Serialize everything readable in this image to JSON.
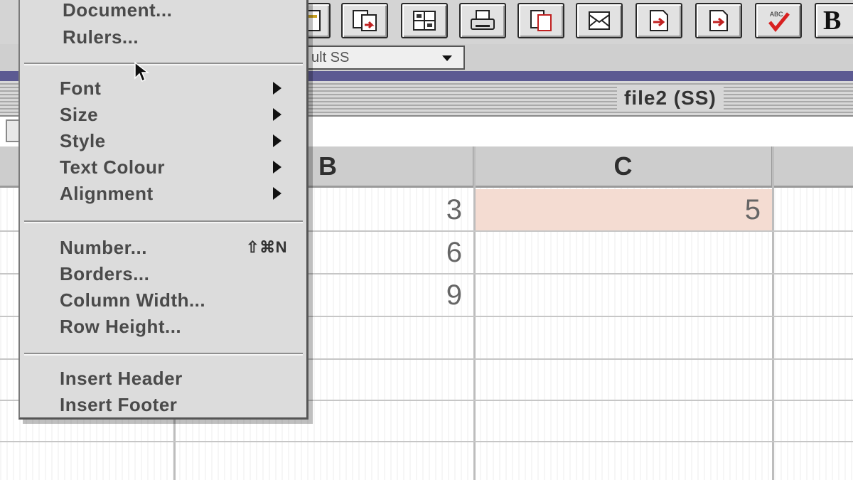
{
  "toolbar": {
    "buttons": [
      {
        "name": "toolbar-button-1",
        "icon": "document-icon"
      },
      {
        "name": "toolbar-button-2",
        "icon": "merge-icon"
      },
      {
        "name": "toolbar-button-3",
        "icon": "grid-icon"
      },
      {
        "name": "toolbar-button-4",
        "icon": "print-icon"
      },
      {
        "name": "toolbar-button-5",
        "icon": "copy-icon"
      },
      {
        "name": "toolbar-button-6",
        "icon": "envelope-icon"
      },
      {
        "name": "toolbar-button-7",
        "icon": "page-arrow-icon"
      },
      {
        "name": "toolbar-button-8",
        "icon": "page-arrow-icon"
      },
      {
        "name": "toolbar-button-9",
        "icon": "spellcheck-icon"
      }
    ],
    "bold_label": "B"
  },
  "style_select": {
    "value": "ult SS"
  },
  "window": {
    "title": "file2 (SS)"
  },
  "spreadsheet": {
    "columns": [
      "B",
      "C"
    ],
    "cells": {
      "b1": "3",
      "c1": "5",
      "b2": "6",
      "b3": "9"
    }
  },
  "menu": {
    "document": "Document...",
    "rulers": "Rulers...",
    "font": "Font",
    "size": "Size",
    "style": "Style",
    "text_colour": "Text Colour",
    "alignment": "Alignment",
    "number": "Number...",
    "number_shortcut": "⇧⌘N",
    "borders": "Borders...",
    "column_width": "Column Width...",
    "row_height": "Row Height...",
    "insert_header": "Insert Header",
    "insert_footer": "Insert Footer"
  },
  "colors": {
    "accent_strip": "#5c5a92",
    "selected_cell": "#f4dcd2",
    "spellcheck_tick": "#d82020"
  }
}
